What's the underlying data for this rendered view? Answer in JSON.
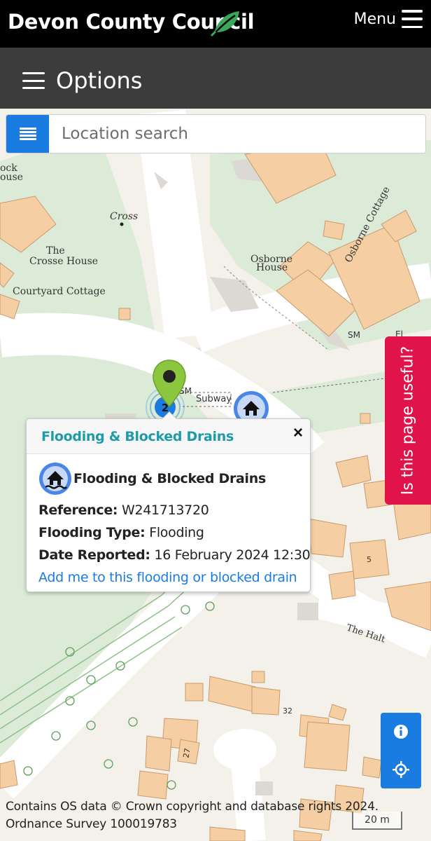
{
  "header": {
    "brand": "Devon County Council",
    "menu_label": "Menu"
  },
  "options_bar": {
    "label": "Options"
  },
  "search": {
    "placeholder": "Location search"
  },
  "map": {
    "labels": {
      "rock_house_1": "ock",
      "rock_house_2": "ouse",
      "cross": "Cross",
      "crosse_house_1": "The",
      "crosse_house_2": "Crosse House",
      "courtyard_cottage": "Courtyard Cottage",
      "osborne_house_1": "Osborne",
      "osborne_house_2": "House",
      "osborne_cottage": "Osborne Cottage",
      "sm_1": "SM",
      "sm_2": "SM",
      "subway": "Subway",
      "el": "El",
      "five": "5",
      "the_halt": "The Halt",
      "thirty_two": "32",
      "twenty_seven": "27"
    },
    "cluster_count": "2",
    "colors": {
      "marker_green": "#8cc63f",
      "flood_blue": "#4a86e8",
      "cluster_blue": "#1a7ce0",
      "building": "#f5cfa3",
      "green_space": "#dcebd8",
      "road": "#ffffff"
    }
  },
  "popup": {
    "title": "Flooding & Blocked Drains",
    "category": "Flooding & Blocked Drains",
    "reference_label": "Reference:",
    "reference_value": "W241713720",
    "flooding_type_label": "Flooding Type:",
    "flooding_type_value": "Flooding",
    "date_reported_label": "Date Reported:",
    "date_reported_value": "16 February 2024 12:30",
    "link_text": "Add me to this flooding or blocked drain",
    "close_symbol": "×"
  },
  "feedback_tab": {
    "label": "Is this page useful?"
  },
  "controls": {
    "info_icon": "info-icon",
    "locate_icon": "crosshair-icon"
  },
  "attribution": {
    "line1": "Contains OS data © Crown copyright and database rights 2024.",
    "line2": "Ordnance Survey 100019783"
  },
  "scale": {
    "label": "20 m"
  }
}
